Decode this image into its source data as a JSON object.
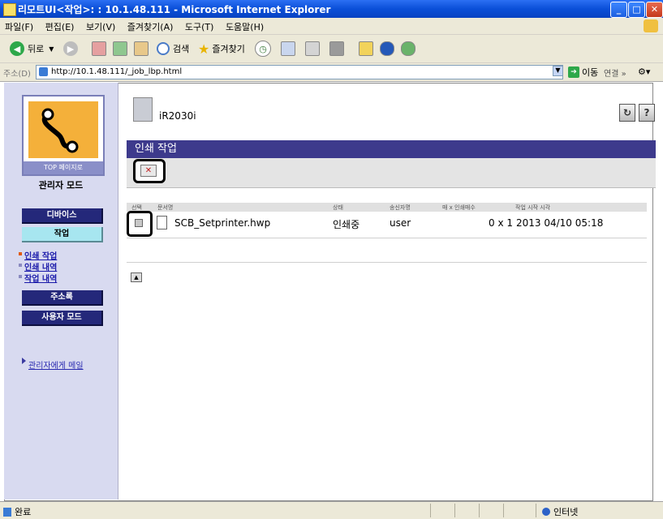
{
  "window": {
    "title": "리모트UI<작업>: : 10.1.48.111 - Microsoft Internet Explorer"
  },
  "menu": [
    "파일(F)",
    "편집(E)",
    "보기(V)",
    "즐겨찾기(A)",
    "도구(T)",
    "도움말(H)"
  ],
  "toolbar": {
    "back_label": "뒤로",
    "search_label": "검색",
    "favorites_label": "즐겨찾기"
  },
  "address": {
    "label": "주소(D)",
    "url": "http://10.1.48.111/_job_lbp.html",
    "go_label": "이동",
    "links_label": "연결"
  },
  "sidebar": {
    "logo_caption": "TOP 페이지로",
    "mode_heading": "관리자 모드",
    "buttons": {
      "device": "디바이스",
      "job": "작업",
      "address_book": "주소록",
      "user_mode": "사용자 모드"
    },
    "sublinks": [
      "인쇄 작업",
      "인쇄 내역",
      "작업 내역"
    ],
    "mail_link": "관리자에게 메일"
  },
  "main": {
    "device_name": "iR2030i",
    "help_buttons": [
      "↻",
      "?"
    ],
    "section_title": "인쇄 작업",
    "table": {
      "headers": [
        "선택",
        "문서명",
        "상태",
        "송신자명",
        "매 x 인쇄매수",
        "작업 시작 시각"
      ],
      "rows": [
        {
          "document": "SCB_Setprinter.hwp",
          "status": "인쇄중",
          "sender": "user",
          "copies": "0 x 1",
          "start_time": "2013 04/10 05:18"
        }
      ]
    }
  },
  "status": {
    "left": "완료",
    "zone": "인터넷"
  },
  "colors": {
    "section_header": "#3d3a8c",
    "nav_button": "#24287a",
    "nav_active": "#a7e6f0",
    "sidebar_bg": "#d8daf0"
  }
}
